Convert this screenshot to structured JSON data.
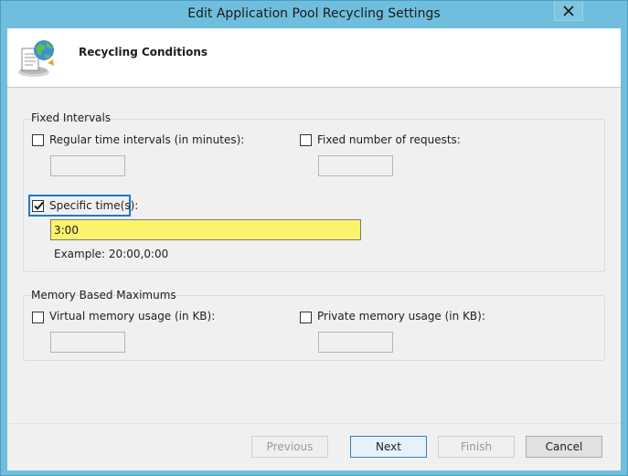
{
  "window": {
    "title": "Edit Application Pool Recycling Settings"
  },
  "header": {
    "title": "Recycling Conditions",
    "icon": "recycle-globe-icon"
  },
  "fixed_intervals": {
    "label": "Fixed Intervals",
    "regular_time": {
      "label": "Regular time intervals (in minutes):",
      "checked": false,
      "value": ""
    },
    "fixed_requests": {
      "label": "Fixed number of requests:",
      "checked": false,
      "value": ""
    },
    "specific_times": {
      "label": "Specific time(s):",
      "checked": true,
      "value": "3:00",
      "example": "Example: 20:00,0:00"
    }
  },
  "memory": {
    "label": "Memory Based Maximums",
    "virtual": {
      "label": "Virtual memory usage (in KB):",
      "checked": false,
      "value": ""
    },
    "private": {
      "label": "Private memory usage (in KB):",
      "checked": false,
      "value": ""
    }
  },
  "buttons": {
    "previous": "Previous",
    "next": "Next",
    "finish": "Finish",
    "cancel": "Cancel"
  },
  "colors": {
    "titlebar": "#6fbedd",
    "highlight_field": "#fbf36b",
    "focus": "#1f7bc0"
  }
}
